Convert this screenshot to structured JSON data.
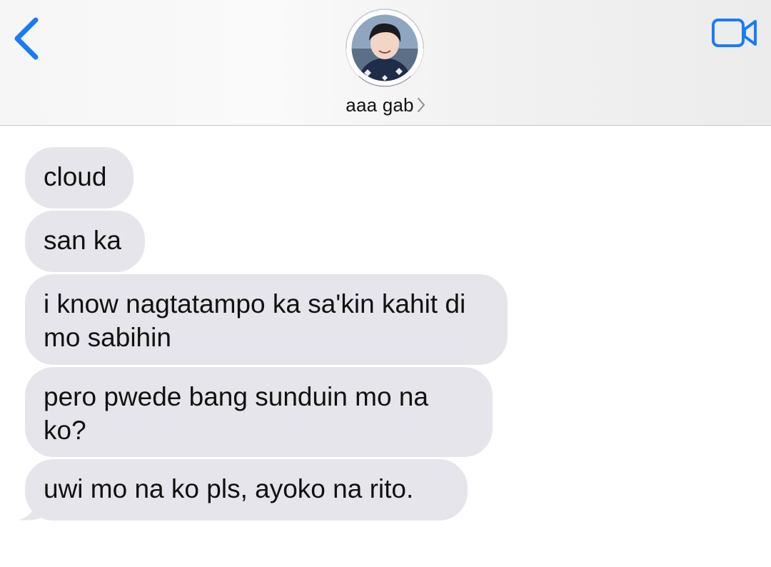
{
  "header": {
    "contact_name": "aaa gab",
    "back_icon": "chevron-left-icon",
    "video_icon": "video-camera-icon",
    "accent_color": "#1a7cf5"
  },
  "messages": [
    {
      "text": "cloud",
      "direction": "incoming"
    },
    {
      "text": "san ka",
      "direction": "incoming"
    },
    {
      "text": "i know nagtatampo ka sa'kin kahit di mo sabihin",
      "direction": "incoming"
    },
    {
      "text": "pero pwede bang sunduin mo na ko?",
      "direction": "incoming"
    },
    {
      "text": "uwi mo na ko pls, ayoko na rito.",
      "direction": "incoming"
    }
  ],
  "colors": {
    "incoming_bubble": "#e6e5eb",
    "text": "#111111"
  }
}
